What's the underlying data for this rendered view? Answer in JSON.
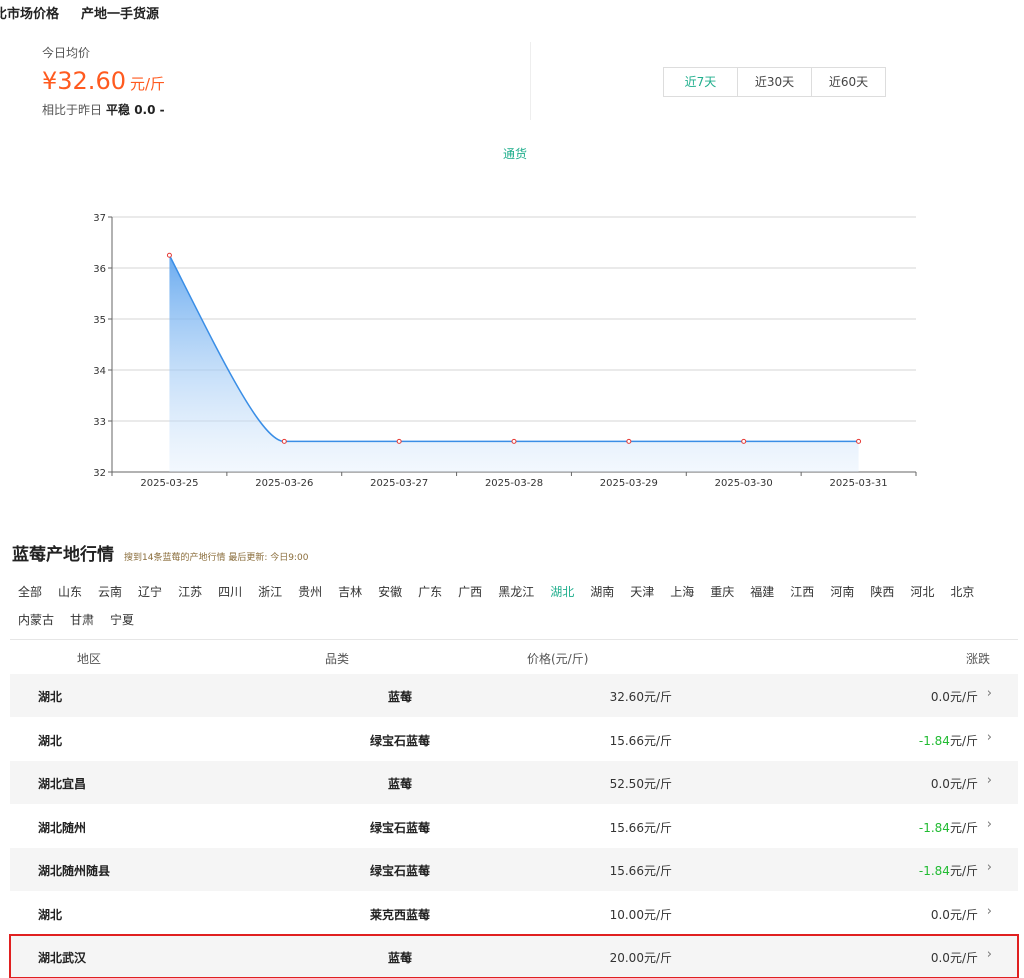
{
  "nav": {
    "item1": "比市场价格",
    "item2": "产地一手货源"
  },
  "price": {
    "label": "今日均价",
    "value": "¥32.60",
    "unit": "元/斤",
    "compare_label": "相比于昨日",
    "compare_value": "平稳 0.0 -"
  },
  "range_tabs": [
    "近7天",
    "近30天",
    "近60天"
  ],
  "chart_data": {
    "type": "area",
    "legend": "通货",
    "x": [
      "2025-03-25",
      "2025-03-26",
      "2025-03-27",
      "2025-03-28",
      "2025-03-29",
      "2025-03-30",
      "2025-03-31"
    ],
    "y": [
      36.25,
      32.6,
      32.6,
      32.6,
      32.6,
      32.6,
      32.6
    ],
    "ylim": [
      32,
      37
    ],
    "yticks": [
      32,
      33,
      34,
      35,
      36,
      37
    ],
    "grid": true,
    "line_color": "#3a8ee6",
    "point_color": "#e53935"
  },
  "section": {
    "title": "蓝莓产地行情",
    "subtitle": "搜到14条蓝莓的产地行情 最后更新: 今日9:00"
  },
  "regions": [
    "全部",
    "山东",
    "云南",
    "辽宁",
    "江苏",
    "四川",
    "浙江",
    "贵州",
    "吉林",
    "安徽",
    "广东",
    "广西",
    "黑龙江",
    "湖北",
    "湖南",
    "天津",
    "上海",
    "重庆",
    "福建",
    "江西",
    "河南",
    "陕西",
    "河北",
    "北京",
    "内蒙古",
    "甘肃",
    "宁夏"
  ],
  "active_region": "湖北",
  "table": {
    "headers": {
      "region": "地区",
      "kind": "品类",
      "price": "价格(元/斤)",
      "change": "涨跌"
    },
    "rows": [
      {
        "region": "湖北",
        "kind": "蓝莓",
        "price": "32.60元/斤",
        "change_num": "0.0",
        "change_unit": "元/斤",
        "down": false
      },
      {
        "region": "湖北",
        "kind": "绿宝石蓝莓",
        "price": "15.66元/斤",
        "change_num": "-1.84",
        "change_unit": "元/斤",
        "down": true
      },
      {
        "region": "湖北宜昌",
        "kind": "蓝莓",
        "price": "52.50元/斤",
        "change_num": "0.0",
        "change_unit": "元/斤",
        "down": false
      },
      {
        "region": "湖北随州",
        "kind": "绿宝石蓝莓",
        "price": "15.66元/斤",
        "change_num": "-1.84",
        "change_unit": "元/斤",
        "down": true
      },
      {
        "region": "湖北随州随县",
        "kind": "绿宝石蓝莓",
        "price": "15.66元/斤",
        "change_num": "-1.84",
        "change_unit": "元/斤",
        "down": true
      },
      {
        "region": "湖北",
        "kind": "莱克西蓝莓",
        "price": "10.00元/斤",
        "change_num": "0.0",
        "change_unit": "元/斤",
        "down": false
      },
      {
        "region": "湖北武汉",
        "kind": "蓝莓",
        "price": "20.00元/斤",
        "change_num": "0.0",
        "change_unit": "元/斤",
        "down": false
      }
    ]
  },
  "highlighted_row": 6
}
